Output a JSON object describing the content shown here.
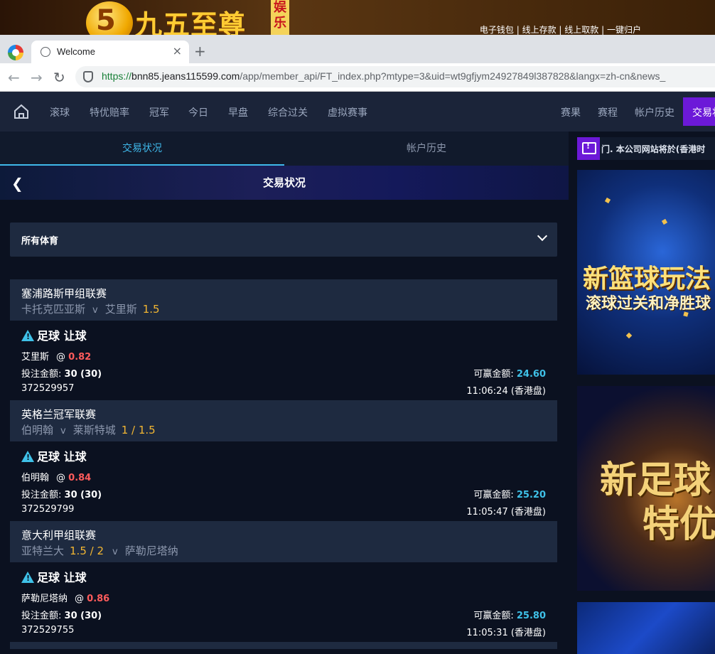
{
  "banner": {
    "logo_numeral": "5",
    "logo_text": "九五至尊",
    "logo_badge": "娱乐",
    "links": [
      "电子钱包",
      "线上存款",
      "线上取款",
      "一键归户"
    ]
  },
  "browser": {
    "tab_title": "Welcome",
    "url_scheme": "https://",
    "url_host": "bnn85.jeans115599.com",
    "url_path": "/app/member_api/FT_index.php?mtype=3&uid=wt9gfjym24927849l387828&langx=zh-cn&news_"
  },
  "nav": {
    "left_items": [
      "滚球",
      "特优赔率",
      "冠军",
      "今日",
      "早盘",
      "综合过关",
      "虚拟赛事"
    ],
    "right_items": [
      "赛果",
      "赛程",
      "帐户历史"
    ],
    "highlight": "交易状况"
  },
  "subtabs": [
    "交易状况",
    "帐户历史"
  ],
  "page_title": "交易状况",
  "sport_filter": "所有体育",
  "bets": [
    {
      "league": "塞浦路斯甲组联赛",
      "home": "卡托克匹亚斯",
      "vs": "v",
      "away": "艾里斯",
      "handicap": "1.5",
      "bet_type": "足球 让球",
      "pick": "艾里斯",
      "odds_prefix": "@",
      "odds": "0.82",
      "stake_label": "投注金额:",
      "stake": "30 (30)",
      "win_label": "可赢金额:",
      "win": "24.60",
      "ticket": "372529957",
      "time": "11:06:24 (香港盘)"
    },
    {
      "league": "英格兰冠军联赛",
      "home": "伯明翰",
      "vs": "v",
      "away": "莱斯特城",
      "handicap": "1 / 1.5",
      "bet_type": "足球 让球",
      "pick": "伯明翰",
      "odds_prefix": "@",
      "odds": "0.84",
      "stake_label": "投注金额:",
      "stake": "30 (30)",
      "win_label": "可赢金额:",
      "win": "25.20",
      "ticket": "372529799",
      "time": "11:05:47 (香港盘)"
    },
    {
      "league": "意大利甲组联赛",
      "home": "亚特兰大",
      "vs": "v",
      "away": "萨勒尼塔纳",
      "handicap": "1.5 / 2",
      "bet_type": "足球 让球",
      "pick": "萨勒尼塔纳",
      "odds_prefix": "@",
      "odds": "0.86",
      "stake_label": "投注金额:",
      "stake": "30 (30)",
      "win_label": "可赢金额:",
      "win": "25.80",
      "ticket": "372529755",
      "time": "11:05:31 (香港盘)"
    }
  ],
  "marquee": "门. 本公司网站将於(香港时",
  "promos": [
    {
      "title": "新篮球玩法",
      "subtitle": "滚球过关和净胜球"
    },
    {
      "title": "新足球",
      "subtitle": "特优"
    }
  ],
  "colors": {
    "accent_purple": "#6c19d8",
    "active_tab": "#3fb8ea",
    "odds_red": "#ff5c5c",
    "win_cyan": "#3fc1e8",
    "handicap_gold": "#f2b632"
  },
  "icons": [
    "home-icon",
    "chevron-left-icon",
    "chevron-down-icon",
    "warning-icon",
    "message-icon",
    "globe-icon",
    "close-icon",
    "plus-icon",
    "back-arrow-icon",
    "forward-arrow-icon",
    "reload-icon",
    "shield-icon"
  ]
}
